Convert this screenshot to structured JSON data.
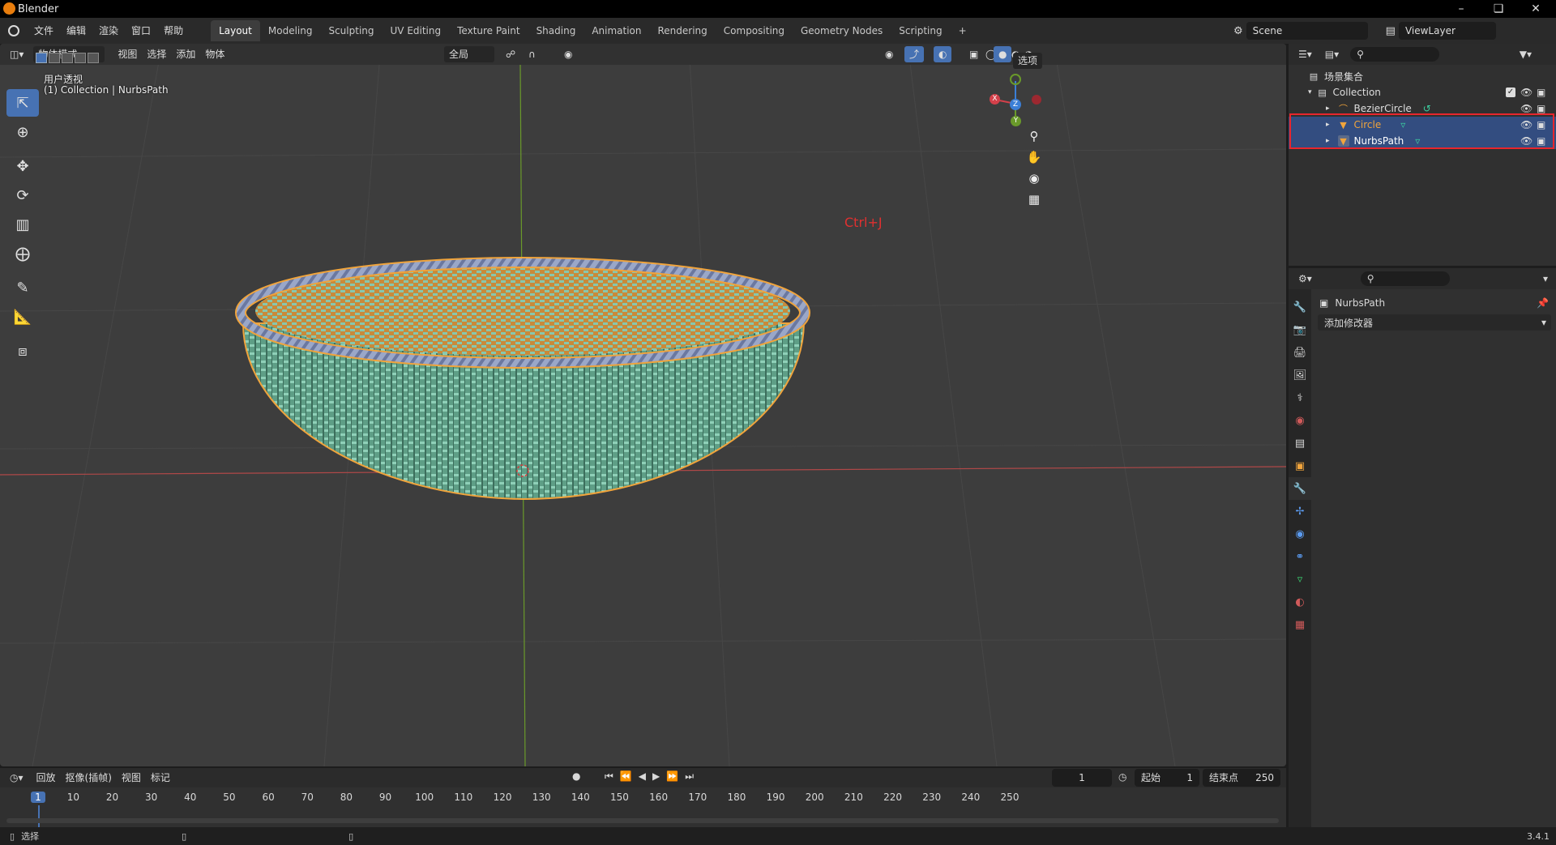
{
  "window": {
    "title": "Blender"
  },
  "menu": [
    "文件",
    "编辑",
    "渲染",
    "窗口",
    "帮助"
  ],
  "workspaces": [
    "Layout",
    "Modeling",
    "Sculpting",
    "UV Editing",
    "Texture Paint",
    "Shading",
    "Animation",
    "Rendering",
    "Compositing",
    "Geometry Nodes",
    "Scripting"
  ],
  "workspace_add": "+",
  "scene": {
    "label": "Scene",
    "view_layer": "ViewLayer"
  },
  "viewport": {
    "mode": "物体模式",
    "menus": [
      "视图",
      "选择",
      "添加",
      "物体"
    ],
    "transform_orientation": "全局",
    "options_label": "选项",
    "view_name": "用户透视",
    "context_info": "(1) Collection | NurbsPath",
    "annotation": "Ctrl+J",
    "gizmo": {
      "x": "X",
      "y": "Y",
      "z": "Z"
    }
  },
  "outliner": {
    "root": "场景集合",
    "collection": "Collection",
    "items": [
      {
        "name": "BezierCircle",
        "selected": false,
        "color": "#dedede"
      },
      {
        "name": "Circle",
        "selected": true,
        "color": "#f0a43c"
      },
      {
        "name": "NurbsPath",
        "selected": true,
        "color": "#ffffff"
      }
    ]
  },
  "properties": {
    "object_name": "NurbsPath",
    "add_modifier": "添加修改器"
  },
  "timeline": {
    "playback": "回放",
    "keying": "抠像(插帧)",
    "view": "视图",
    "marker": "标记",
    "current_frame": "1",
    "start_label": "起始",
    "start_value": "1",
    "end_label": "结束点",
    "end_value": "250",
    "ruler": [
      "1",
      "10",
      "20",
      "30",
      "40",
      "50",
      "60",
      "70",
      "80",
      "90",
      "100",
      "110",
      "120",
      "130",
      "140",
      "150",
      "160",
      "170",
      "180",
      "190",
      "200",
      "210",
      "220",
      "230",
      "240",
      "250"
    ]
  },
  "status": {
    "select_label": "选择",
    "version": "3.4.1"
  },
  "colors": {
    "accent": "#4772b3",
    "selection_outline": "#e8262d",
    "object_active": "#f0a43c",
    "basket_green": "#6fb49a",
    "axis_red": "#c43c3c",
    "axis_green": "#6a9a2a"
  }
}
